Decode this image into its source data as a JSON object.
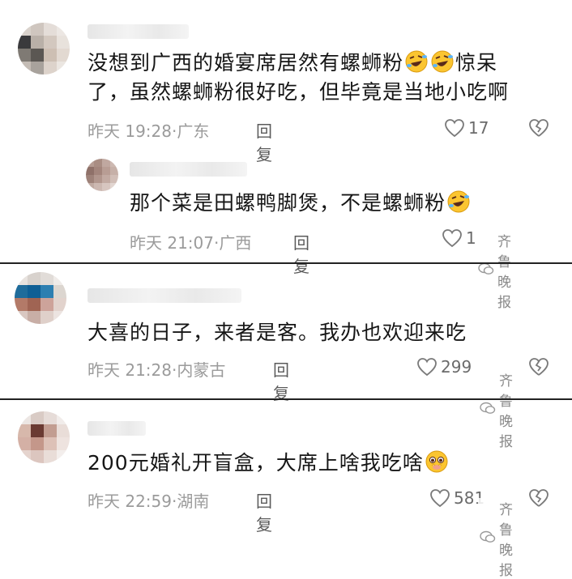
{
  "comments": [
    {
      "text_line1": "没想到广西的婚宴席居然有螺蛳粉",
      "text_line1_tail": "惊呆",
      "text_line2": "了，虽然螺蛳粉很好吃，但毕竟是当地小吃啊",
      "time": "昨天 19:28",
      "location": "广东",
      "reply_label": "回复",
      "likes": "17",
      "emoji": "rofl-emoji"
    },
    {
      "text": "那个菜是田螺鸭脚煲，不是螺蛳粉",
      "time": "昨天 21:07",
      "location": "广西",
      "reply_label": "回复",
      "likes": "1",
      "emoji": "rofl-emoji"
    },
    {
      "text": "大喜的日子，来者是客。我办也欢迎来吃",
      "time": "昨天 21:28",
      "location": "内蒙古",
      "reply_label": "回复",
      "likes": "299"
    },
    {
      "text": "200元婚礼开盲盒，大席上啥我吃啥",
      "time": "昨天 22:59",
      "location": "湖南",
      "reply_label": "回复",
      "likes": "581",
      "emoji": "pleading-emoji"
    }
  ],
  "watermark": "齐鲁晚报",
  "separator": "·"
}
